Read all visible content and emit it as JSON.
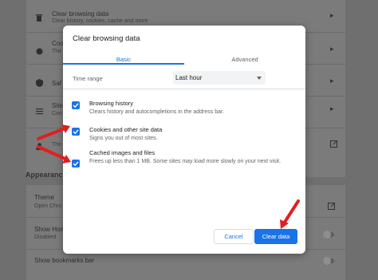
{
  "background": {
    "rows": [
      {
        "title": "Clear browsing data",
        "sub": "Clear history, cookies, cache and more"
      },
      {
        "title": "Coo",
        "sub": "Thir"
      },
      {
        "title": "Saf",
        "sub": ""
      },
      {
        "title": "Site",
        "sub": "Con"
      },
      {
        "title": "Thir",
        "sub": ""
      }
    ],
    "section": "Appearance",
    "appearance_rows": [
      {
        "title": "Theme",
        "sub": "Open Chro"
      },
      {
        "title": "Show Hom",
        "sub": "Disabled"
      },
      {
        "title": "Show bookmarks bar",
        "sub": ""
      }
    ]
  },
  "dialog": {
    "title": "Clear browsing data",
    "tabs": [
      "Basic",
      "Advanced"
    ],
    "time_range_label": "Time range",
    "time_range_value": "Last hour",
    "items": [
      {
        "title": "Browsing history",
        "sub": "Clears history and autocompletions in the address bar.",
        "checked": true
      },
      {
        "title": "Cookies and other site data",
        "sub": "Signs you out of most sites.",
        "checked": true
      },
      {
        "title": "Cached images and files",
        "sub": "Frees up less than 1 MB. Some sites may load more slowly on your next visit.",
        "checked": true
      }
    ],
    "cancel_label": "Cancel",
    "clear_label": "Clear data"
  },
  "colors": {
    "accent": "#1a73e8",
    "annotation": "#e02020"
  }
}
